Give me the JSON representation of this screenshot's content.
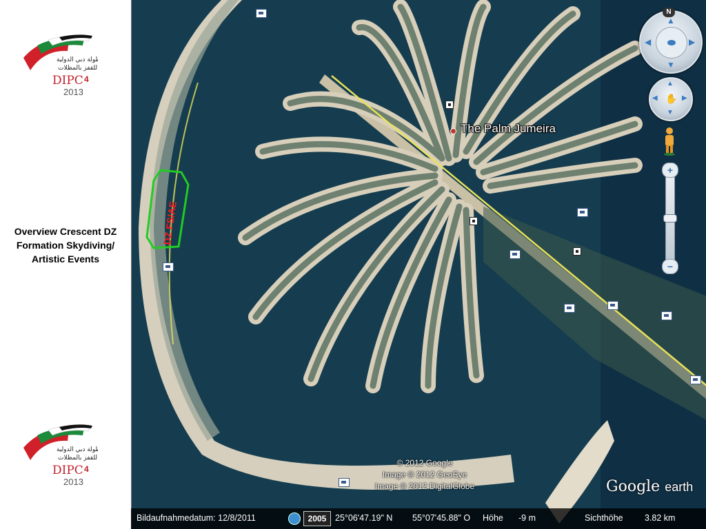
{
  "side_panel": {
    "caption": "Overview Crescent DZ Formation Skydiving/ Artistic Events",
    "logo": {
      "arabic_lines": [
        "بطولة دبي الدولية",
        "للقفز بالمظلات"
      ],
      "name": "DIPC",
      "number": "4",
      "year": "2013"
    }
  },
  "map": {
    "place_label": "The Palm Jumeira",
    "dz_annotation": "DZ FS/AE",
    "copyright_lines": [
      "© 2012 Google",
      "Image © 2012 GeoEye",
      "Image © 2012 DigitalGlobe"
    ],
    "brand": {
      "primary": "Google",
      "secondary": "earth"
    },
    "colors": {
      "water": "#14394a",
      "sand": "#d9d0bd",
      "road": "#e8e25a",
      "dz_outline": "#22cc22",
      "dz_text": "#ff1a1a"
    }
  },
  "nav": {
    "north_label": "N",
    "zoom_in": "+",
    "zoom_out": "−",
    "icons": [
      "look-icon",
      "hand-icon",
      "pegman-icon"
    ]
  },
  "status_bar": {
    "date_label": "Bildaufnahmedatum: 12/8/2011",
    "year_badge": "2005",
    "lat": "25°06'47.19\" N",
    "lon": "55°07'45.88\" O",
    "elevation_label": "Höhe",
    "elevation_value": "-9 m",
    "eye_alt_label": "Sichthöhe",
    "eye_alt_value": "3.82 km"
  }
}
